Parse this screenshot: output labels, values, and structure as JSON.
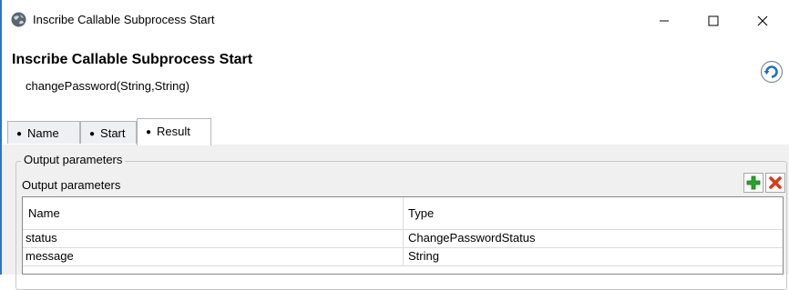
{
  "window": {
    "title": "Inscribe Callable Subprocess Start",
    "controls": [
      "minimize",
      "maximize",
      "close"
    ]
  },
  "header": {
    "title": "Inscribe Callable Subprocess Start",
    "signature": "changePassword(String,String)",
    "refresh_icon": "refresh-icon"
  },
  "tabs": [
    {
      "label": "Name",
      "active": false
    },
    {
      "label": "Start",
      "active": false
    },
    {
      "label": "Result",
      "active": true
    }
  ],
  "output": {
    "group_label": "Output parameters",
    "section_label": "Output parameters",
    "columns": [
      "Name",
      "Type"
    ],
    "rows": [
      {
        "name": "status",
        "type": "ChangePasswordStatus"
      },
      {
        "name": "message",
        "type": "String"
      }
    ],
    "actions": [
      "add",
      "remove"
    ]
  },
  "colors": {
    "accent": "#2f73c8",
    "add_green": "#2aa52a",
    "remove_red": "#d93a1a",
    "panel_bg": "#f0f0f0"
  }
}
